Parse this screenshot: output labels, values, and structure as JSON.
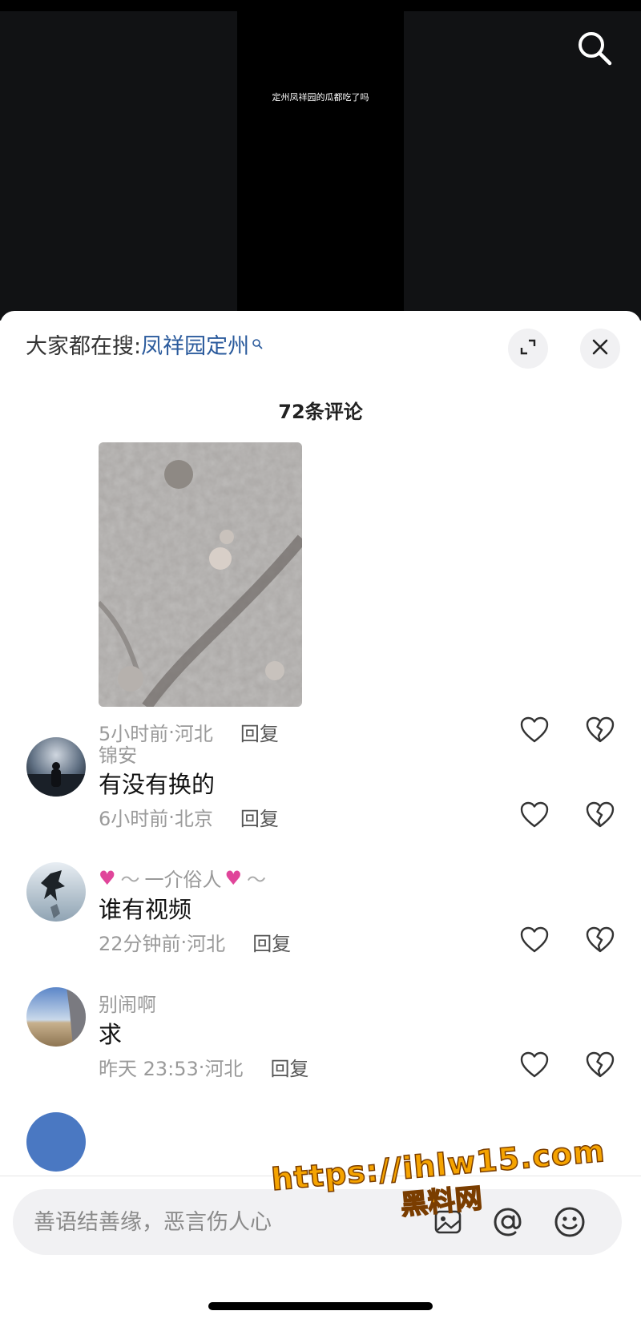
{
  "video": {
    "caption": "定州凤祥园的瓜都吃了吗"
  },
  "sheet": {
    "hot_search_prefix": "大家都在搜:",
    "hot_search_keyword": "凤祥园定州",
    "comment_count": "72条评论"
  },
  "comments": [
    {
      "username": "",
      "text": "",
      "has_image": true,
      "time": "5小时前",
      "location": "河北",
      "reply_label": "回复"
    },
    {
      "username": "锦安",
      "text": "有没有换的",
      "time": "6小时前",
      "location": "北京",
      "reply_label": "回复"
    },
    {
      "username": "一介俗人",
      "text": "谁有视频",
      "time": "22分钟前",
      "location": "河北",
      "reply_label": "回复"
    },
    {
      "username": "别闹啊",
      "text": "求",
      "time": "昨天 23:53",
      "location": "河北",
      "reply_label": "回复"
    }
  ],
  "meta_separator": " · ",
  "input": {
    "placeholder": "善语结善缘，恶言伤人心"
  },
  "watermark": {
    "url": "https://ihlw15.com",
    "name": "黑料网"
  },
  "icons": {
    "top_search": "search-icon",
    "expand": "expand-icon",
    "close": "close-icon",
    "like": "heart-icon",
    "dislike": "broken-heart-icon",
    "image": "image-icon",
    "mention": "at-icon",
    "emoji": "emoji-icon"
  },
  "colors": {
    "keyword": "#2a5a9c",
    "watermark": "#f5a300"
  }
}
